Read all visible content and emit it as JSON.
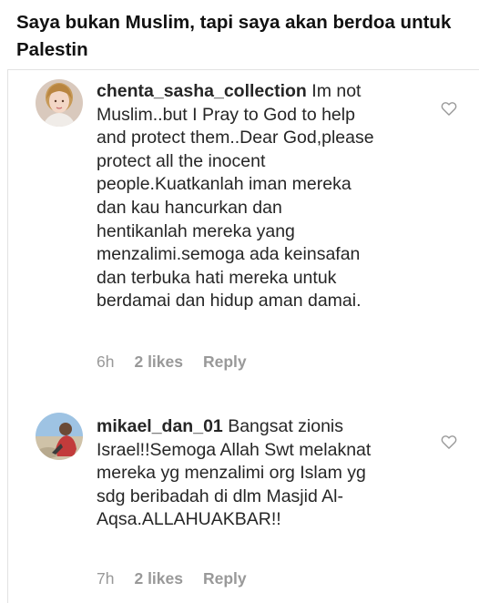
{
  "headline": "Saya bukan Muslim, tapi saya akan berdoa untuk Palestin",
  "comments": [
    {
      "username": "chenta_sasha_collection",
      "text": "Im not Muslim..but I Pray to God to help and protect them..Dear God,please protect all the inocent people.Kuatkanlah iman mereka dan kau hancurkan dan hentikanlah mereka yang menzalimi.semoga ada keinsafan dan terbuka hati mereka untuk berdamai dan hidup aman damai.",
      "time": "6h",
      "likes": "2 likes",
      "reply": "Reply",
      "like_icon": "heart-outline-icon"
    },
    {
      "username": "mikael_dan_01",
      "text": "Bangsat zionis Israel!!Semoga Allah Swt melaknat mereka yg menzalimi org Islam yg sdg beribadah di dlm Masjid Al-Aqsa.ALLAHUAKBAR!!",
      "time": "7h",
      "likes": "2 likes",
      "reply": "Reply",
      "like_icon": "heart-outline-icon"
    }
  ],
  "colors": {
    "text": "#262626",
    "meta": "#999999",
    "heart": "#999999"
  }
}
